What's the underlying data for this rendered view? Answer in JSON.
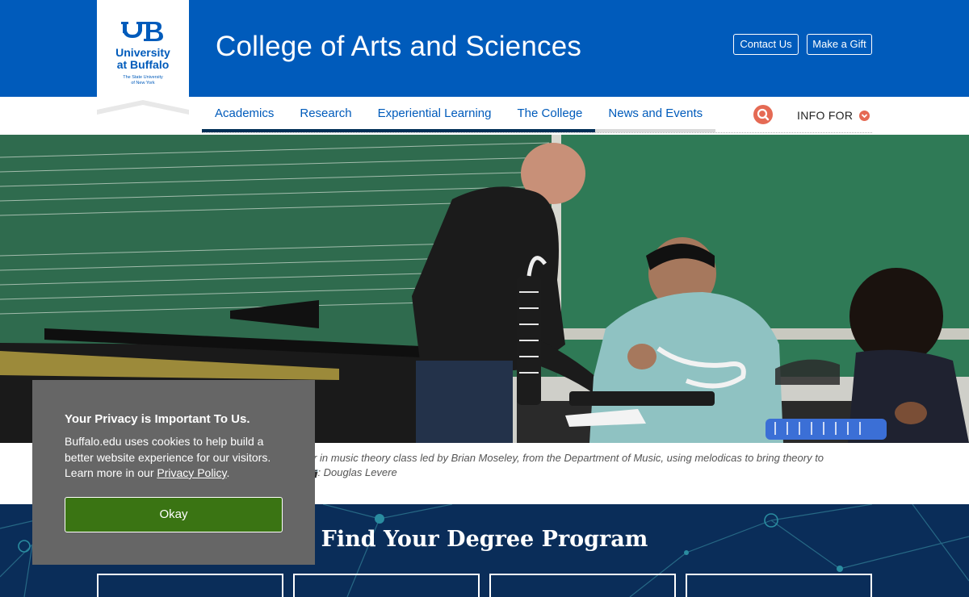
{
  "header": {
    "logo": {
      "line1": "University",
      "line2": "at Buffalo",
      "tagline1": "The State University",
      "tagline2": "of New York"
    },
    "site_title": "College of Arts and Sciences",
    "contact_label": "Contact Us",
    "gift_label": "Make a Gift"
  },
  "nav": {
    "items": [
      "Academics",
      "Research",
      "Experiential Learning",
      "The College",
      "News and Events"
    ],
    "search_icon": "search-icon",
    "info_for_label": "INFO FOR"
  },
  "hero": {
    "caption_line1": "ther in music theory class led by Brian Moseley, from the Department of Music, using melodicas to bring theory to",
    "caption_line2_prefix": "!",
    "caption_line2_suffix": ": Douglas Levere",
    "camera_icon": "camera-icon"
  },
  "degree": {
    "title": "Find Your Degree Program"
  },
  "cookie": {
    "title": "Your Privacy is Important To Us.",
    "text": "Buffalo.edu uses cookies to help build a better website experience for our visitors. Learn more in our",
    "link_label": "Privacy Policy",
    "text_end": ".",
    "button_label": "Okay"
  },
  "colors": {
    "ub_blue": "#005bbb",
    "navy": "#002f56",
    "accent_red": "#e56a54",
    "okay_green": "#3a7413"
  }
}
